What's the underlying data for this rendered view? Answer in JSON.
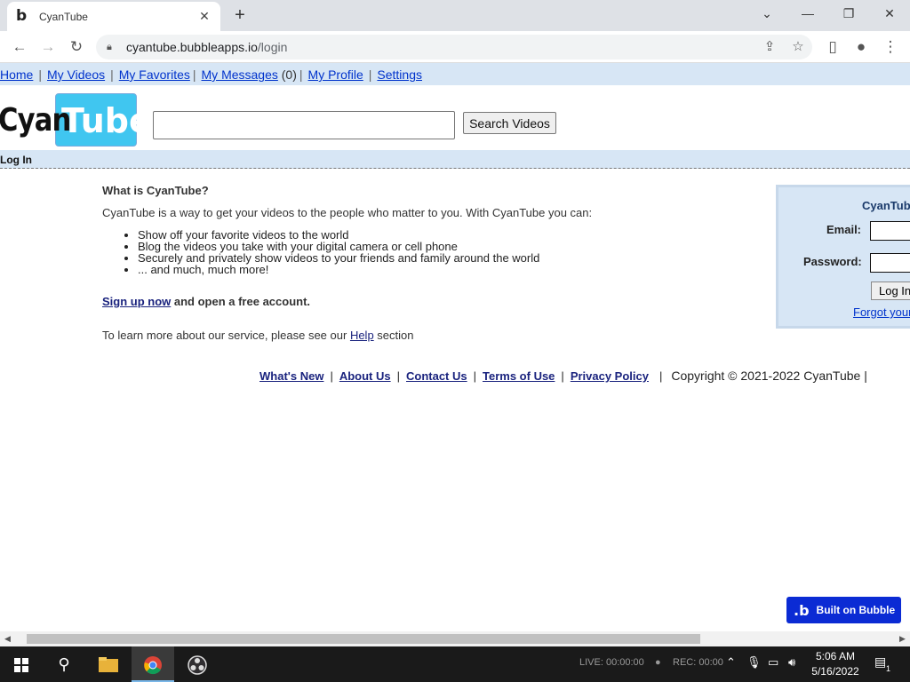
{
  "browser": {
    "tab_title": "CyanTube",
    "favicon": "b",
    "url_host": "cyantube.bubbleapps.io",
    "url_path": "/login"
  },
  "nav": {
    "home": "Home",
    "my_videos": "My Videos",
    "my_favorites": "My Favorites",
    "my_messages": "My Messages",
    "messages_count": "(0)",
    "my_profile": "My Profile",
    "settings": "Settings"
  },
  "logo": {
    "part1": "Cyan",
    "part2": "Tube"
  },
  "search": {
    "button_label": "Search Videos",
    "value": ""
  },
  "login_bar": "Log In",
  "main": {
    "heading": "What is CyanTube?",
    "intro": "CyanTube is a way to get your videos to the people who matter to you. With CyanTube you can:",
    "features": [
      "Show off your favorite videos to the world",
      "Blog the videos you take with your digital camera or cell phone",
      "Securely and privately show videos to your friends and family around the world",
      "... and much, much more!"
    ],
    "signup_link": "Sign up now",
    "signup_rest": " and open a free account.",
    "learn_pre": "To learn more about our service, please see our ",
    "learn_link": "Help",
    "learn_post": " section"
  },
  "login_panel": {
    "title": "CyanTub",
    "email_label": "Email:",
    "password_label": "Password:",
    "login_button": "Log In",
    "forgot": "Forgot your"
  },
  "footer": {
    "whats_new": "What's New",
    "about_us": "About Us",
    "contact_us": "Contact Us",
    "terms": "Terms of Use",
    "privacy": "Privacy Policy",
    "copyright": "Copyright © 2021-2022 CyanTube |"
  },
  "badge": {
    "label": "Built on Bubble"
  },
  "taskbar": {
    "tray_live": "LIVE: 00:00:00",
    "tray_rec": "REC: 00:00",
    "time": "5:06 AM",
    "date": "5/16/2022",
    "notifications": "1"
  },
  "colors": {
    "nav_bg": "#d7e6f5",
    "logo_accent": "#40c6f0",
    "bubble_badge": "#0b2bd4"
  }
}
